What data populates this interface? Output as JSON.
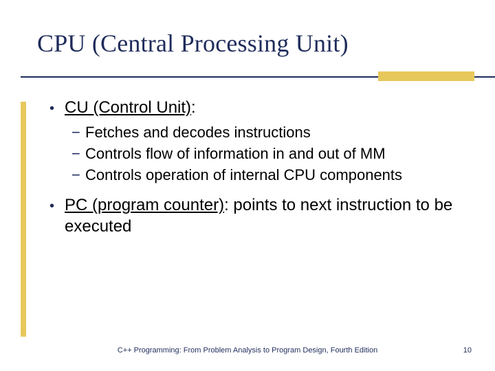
{
  "title": "CPU (Central Processing Unit)",
  "bullets": [
    {
      "lead": "CU (Control Unit)",
      "tail": ":",
      "sub": [
        "Fetches and decodes instructions",
        "Controls flow of information in and out of MM",
        "Controls operation of internal CPU components"
      ]
    },
    {
      "lead": "PC (program counter)",
      "tail": ": points to next instruction to be executed",
      "sub": []
    }
  ],
  "footer": "C++ Programming: From Problem Analysis to Program Design, Fourth Edition",
  "page": "10"
}
